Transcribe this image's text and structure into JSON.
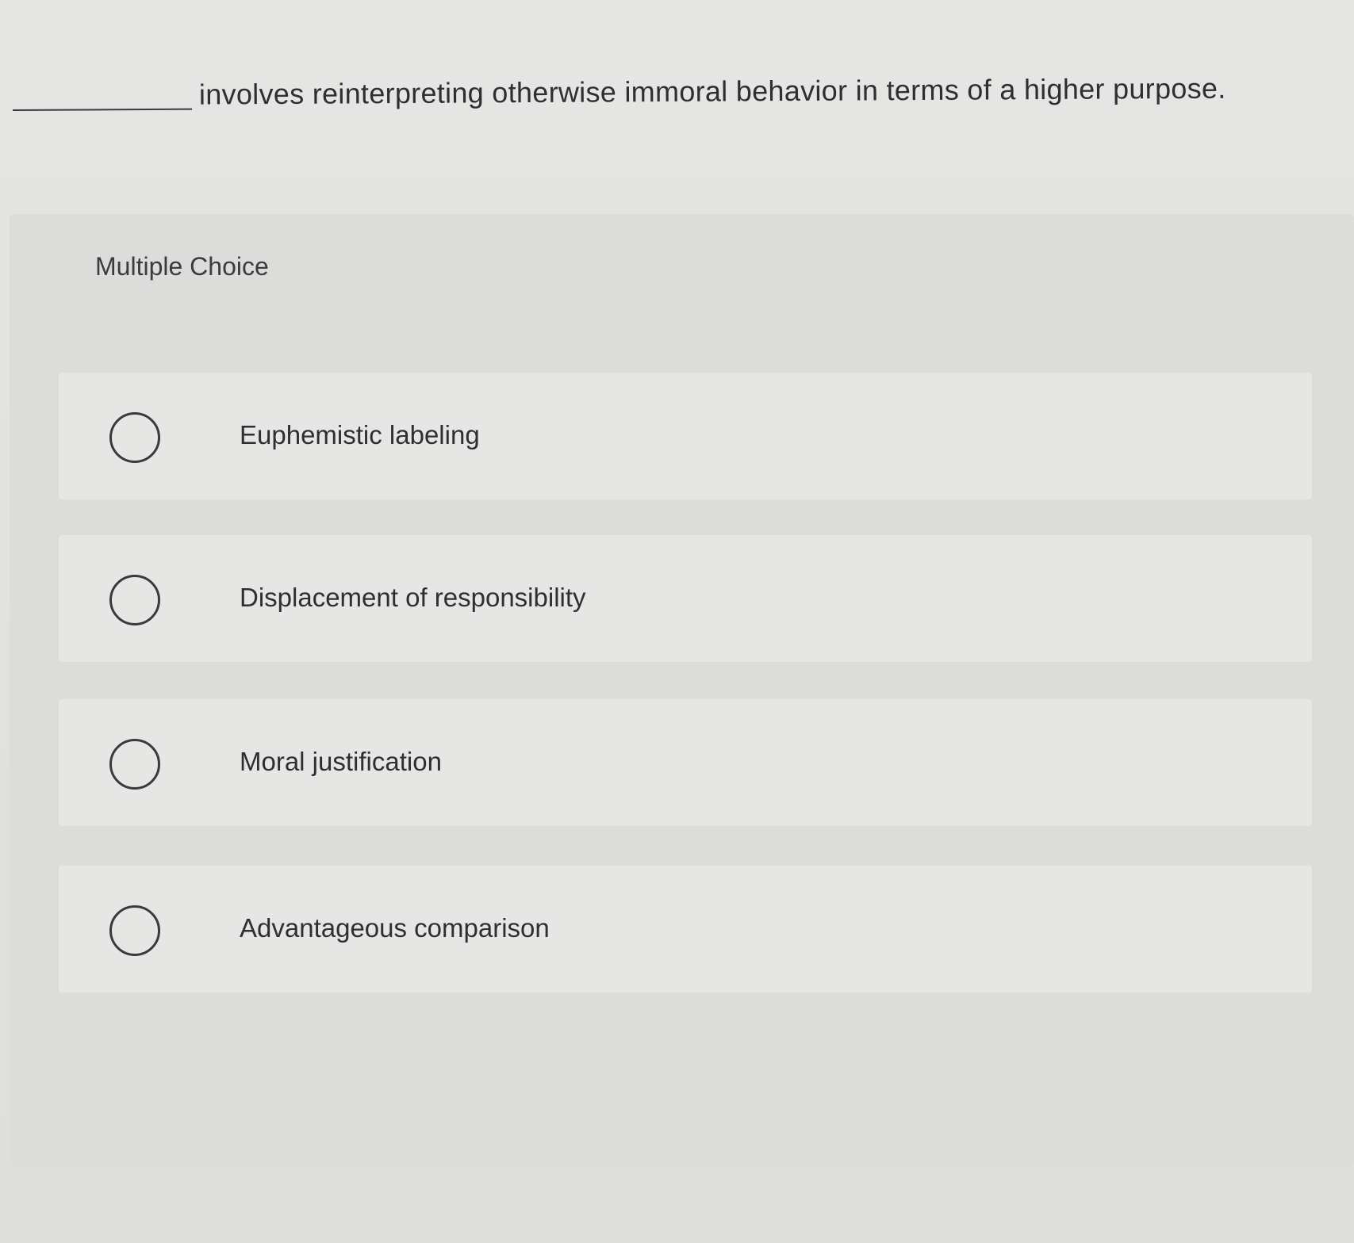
{
  "question": {
    "stem": "involves reinterpreting otherwise immoral behavior in terms of a higher purpose."
  },
  "multiple_choice": {
    "label": "Multiple Choice",
    "options": [
      {
        "label": "Euphemistic labeling",
        "selected": false
      },
      {
        "label": "Displacement of responsibility",
        "selected": false
      },
      {
        "label": "Moral justification",
        "selected": false
      },
      {
        "label": "Advantageous comparison",
        "selected": false
      }
    ]
  }
}
